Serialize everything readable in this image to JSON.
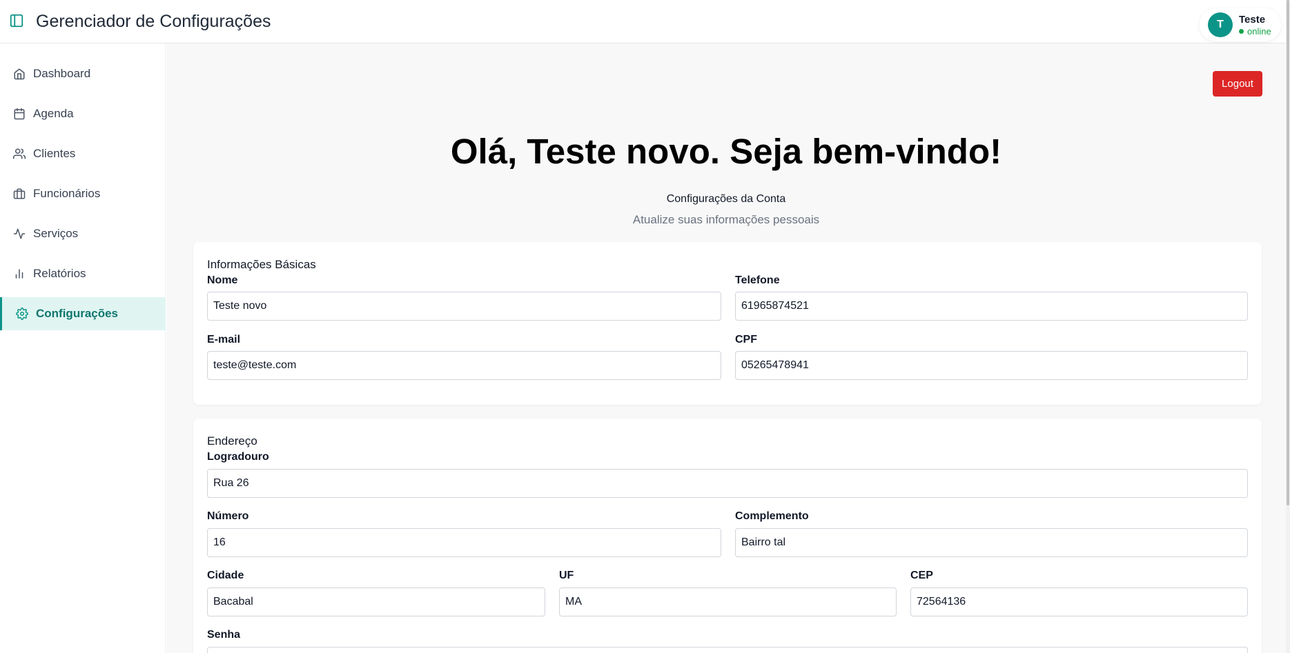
{
  "header": {
    "title": "Gerenciador de Configurações",
    "user": {
      "initial": "T",
      "name": "Teste",
      "status": "online"
    }
  },
  "sidebar": {
    "items": [
      {
        "label": "Dashboard",
        "icon": "home-icon"
      },
      {
        "label": "Agenda",
        "icon": "calendar-icon"
      },
      {
        "label": "Clientes",
        "icon": "users-icon"
      },
      {
        "label": "Funcionários",
        "icon": "briefcase-icon"
      },
      {
        "label": "Serviços",
        "icon": "activity-icon"
      },
      {
        "label": "Relatórios",
        "icon": "bar-chart-icon"
      },
      {
        "label": "Configurações",
        "icon": "gear-icon",
        "active": true
      }
    ]
  },
  "main": {
    "logout_label": "Logout",
    "greeting": "Olá, Teste novo. Seja bem-vindo!",
    "section_title": "Configurações da Conta",
    "section_subtitle": "Atualize suas informações pessoais",
    "basic": {
      "heading": "Informações Básicas",
      "nome_label": "Nome",
      "nome_value": "Teste novo",
      "telefone_label": "Telefone",
      "telefone_value": "61965874521",
      "email_label": "E-mail",
      "email_value": "teste@teste.com",
      "cpf_label": "CPF",
      "cpf_value": "05265478941"
    },
    "address": {
      "heading": "Endereço",
      "logradouro_label": "Logradouro",
      "logradouro_value": "Rua 26",
      "numero_label": "Número",
      "numero_value": "16",
      "complemento_label": "Complemento",
      "complemento_value": "Bairro tal",
      "cidade_label": "Cidade",
      "cidade_value": "Bacabal",
      "uf_label": "UF",
      "uf_value": "MA",
      "cep_label": "CEP",
      "cep_value": "72564136",
      "senha_label": "Senha"
    }
  },
  "colors": {
    "accent": "#0d9488",
    "active_bg": "#e0f5f2",
    "logout": "#dc2626",
    "online": "#16a34a"
  }
}
